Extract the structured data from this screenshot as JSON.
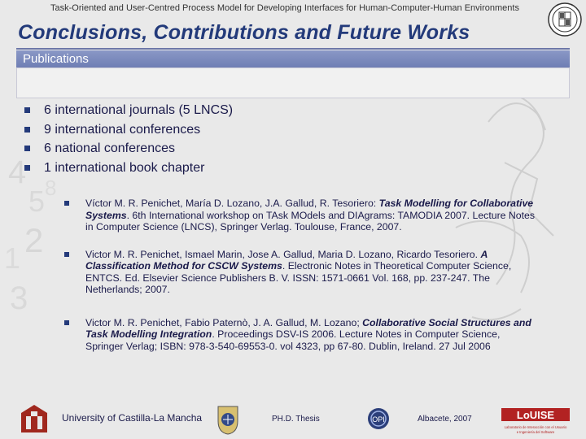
{
  "header": {
    "running_title": "Task-Oriented and User-Centred Process Model for Developing Interfaces for Human-Computer-Human Environments",
    "slide_title": "Conclusions, Contributions and Future Works"
  },
  "section": {
    "label": "Publications"
  },
  "summary": [
    "6 international journals (5 LNCS)",
    "9 international conferences",
    "6 national conferences",
    "1 international book chapter"
  ],
  "references": [
    {
      "before": "Víctor M. R. Penichet, María D. Lozano, J.A. Gallud, R. Tesoriero: ",
      "title": "Task Modelling for Collaborative Systems",
      "after": ". 6th International workshop on TAsk MOdels and DIAgrams: TAMODIA 2007. Lecture Notes in Computer Science (LNCS), Springer Verlag. Toulouse, France, 2007."
    },
    {
      "before": "Victor M. R. Penichet, Ismael Marin, Jose A. Gallud, Maria D. Lozano, Ricardo Tesoriero. ",
      "title": "A Classification Method for CSCW Systems",
      "after": ". Electronic Notes in Theoretical Computer Science, ENTCS. Ed. Elsevier Science Publishers B. V. ISSN: 1571-0661 Vol. 168, pp. 237-247. The Netherlands; 2007."
    },
    {
      "before": "Victor M. R. Penichet, Fabio Paternò, J. A. Gallud, M. Lozano; ",
      "title": "Collaborative Social Structures and Task Modelling Integration",
      "after": ". Proceedings DSV-IS 2006. Lecture Notes in Computer Science, Springer Verlag; ISBN: 978-3-540-69553-0. vol 4323, pp 67-80. Dublin, Ireland. 27 Jul 2006"
    }
  ],
  "footer": {
    "university": "University of Castilla-La Mancha",
    "thesis": "PH.D. Thesis",
    "city_year": "Albacete, 2007",
    "lab_logo_text": "LoUISE",
    "lab_logo_sub1": "Laboratorio de Interacción con el Usuario",
    "lab_logo_sub2": "e Ingeniería del Software",
    "opi_logo_text": "OPI"
  },
  "colors": {
    "title": "#233a7a",
    "section_bar": "#7b89bd",
    "bullet": "#243a7a",
    "lab_logo": "#b22222"
  }
}
